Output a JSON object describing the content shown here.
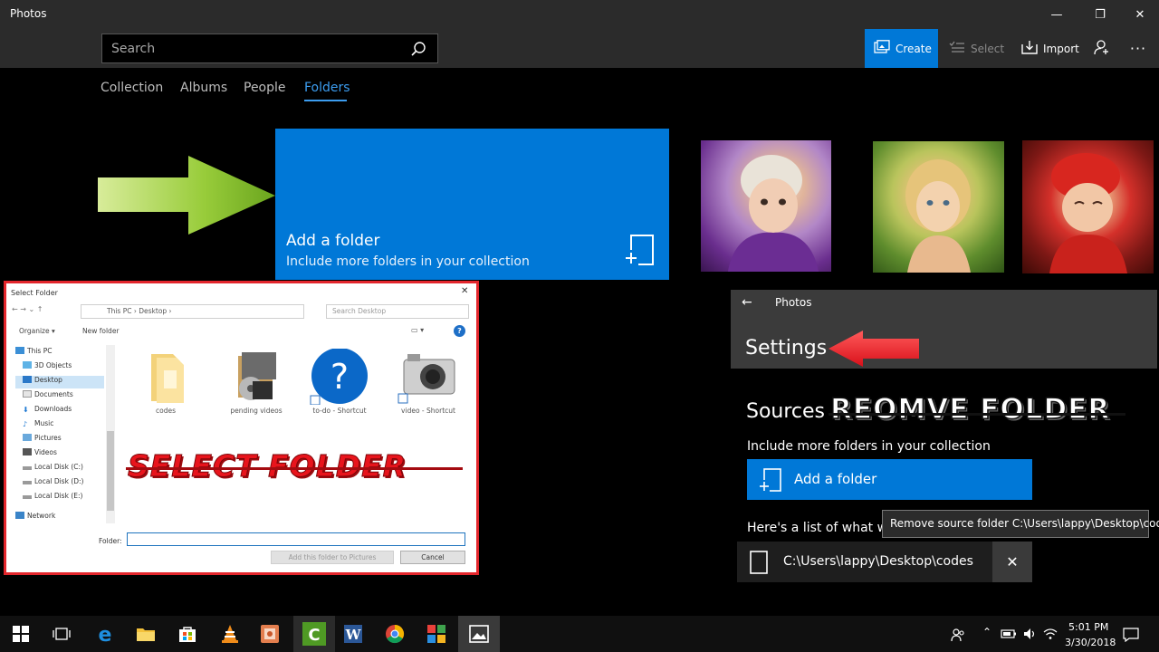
{
  "window": {
    "title": "Photos",
    "minimize": "—",
    "maximize": "❐",
    "close": "✕"
  },
  "toolbar": {
    "search_placeholder": "Search",
    "create_label": "Create",
    "select_label": "Select",
    "import_label": "Import",
    "more_label": "···"
  },
  "nav": {
    "tabs": [
      "Collection",
      "Albums",
      "People",
      "Folders"
    ],
    "selected": "Folders"
  },
  "add_folder_tile": {
    "title": "Add a folder",
    "subtitle": "Include more folders in your collection"
  },
  "dialog": {
    "title": "Select Folder",
    "close": "✕",
    "nav_arrows": "←  →  ⌄  ↑",
    "address": "This PC  ›  Desktop  ›",
    "search_placeholder": "Search Desktop",
    "organize": "Organize ▾",
    "new_folder": "New folder",
    "view_buttons": "▭ ▾",
    "help": "?",
    "tree": [
      "This PC",
      "3D Objects",
      "Desktop",
      "Documents",
      "Downloads",
      "Music",
      "Pictures",
      "Videos",
      "Local Disk (C:)",
      "Local Disk (D:)",
      "Local Disk (E:)",
      "Network"
    ],
    "files": [
      "codes",
      "pending videos",
      "to-do - Shortcut",
      "video - Shortcut"
    ],
    "overlay_text": "SELECT FOLDER",
    "folder_label": "Folder:",
    "add_button": "Add this folder to Pictures",
    "cancel_button": "Cancel"
  },
  "settings": {
    "back": "←",
    "app_name": "Photos",
    "title": "Settings",
    "sources_title": "Sources",
    "overlay_text": "REOMVE FOLDER",
    "sources_subtitle": "Include more folders in your collection",
    "add_button": "Add a folder",
    "list_heading": "Here's a list of what we",
    "tooltip": "Remove source folder C:\\Users\\lappy\\Desktop\\codes",
    "source_path": "C:\\Users\\lappy\\Desktop\\codes",
    "remove": "✕"
  },
  "taskbar": {
    "apps": [
      "start-icon",
      "task-view-icon",
      "edge-icon",
      "file-explorer-icon",
      "store-icon",
      "vlc-icon",
      "media-app-icon",
      "camtasia-icon",
      "word-icon",
      "chrome-icon",
      "tiles-app-icon",
      "photos-icon"
    ],
    "tray_chevron": "⌃",
    "time": "5:01 PM",
    "date": "3/30/2018"
  },
  "colors": {
    "accent": "#0078d7",
    "active_tab": "#3c9df0",
    "overlay_red": "#e8141c",
    "dialog_border": "#e3262c"
  }
}
